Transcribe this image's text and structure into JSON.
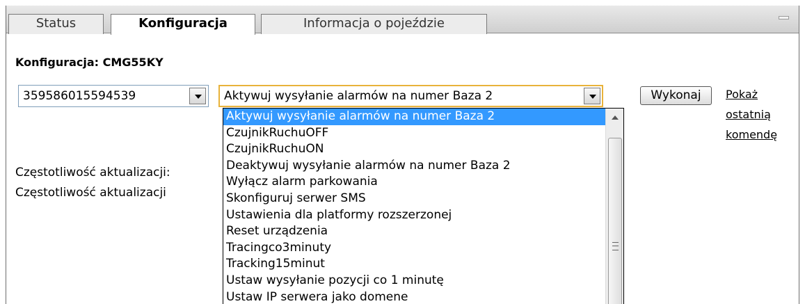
{
  "tabs": [
    {
      "label": "Status"
    },
    {
      "label": "Konfiguracja",
      "active": true
    },
    {
      "label": "Informacja o pojeździe"
    }
  ],
  "header": {
    "title": "Konfiguracja: CMG55KY"
  },
  "device_select": {
    "value": "359586015594539"
  },
  "command_select": {
    "value": "Aktywuj wysyłanie alarmów na numer Baza 2",
    "options": [
      "Aktywuj wysyłanie alarmów na numer Baza 2",
      "CzujnikRuchuOFF",
      "CzujnikRuchuON",
      "Deaktywuj wysyłanie alarmów na numer Baza 2",
      "Wyłącz alarm parkowania",
      "Skonfiguruj serwer SMS",
      "Ustawienia dla platformy rozszerzonej",
      "Reset urządzenia",
      "Tracingco3minuty",
      "Tracking15minut",
      "Ustaw wysyłanie pozycji co 1 minutę",
      "Ustaw IP serwera jako domene"
    ]
  },
  "execute_button": {
    "label": "Wykonaj"
  },
  "show_last_link": {
    "line1": "Pokaż",
    "line2": "ostatnią",
    "line3": "komendę"
  },
  "labels": {
    "freq1": "Częstotliwość aktualizacji:",
    "freq2": "Częstotliwość aktualizacji"
  },
  "colors": {
    "selection": "#3399ff",
    "focus_border": "#e8b23a"
  }
}
